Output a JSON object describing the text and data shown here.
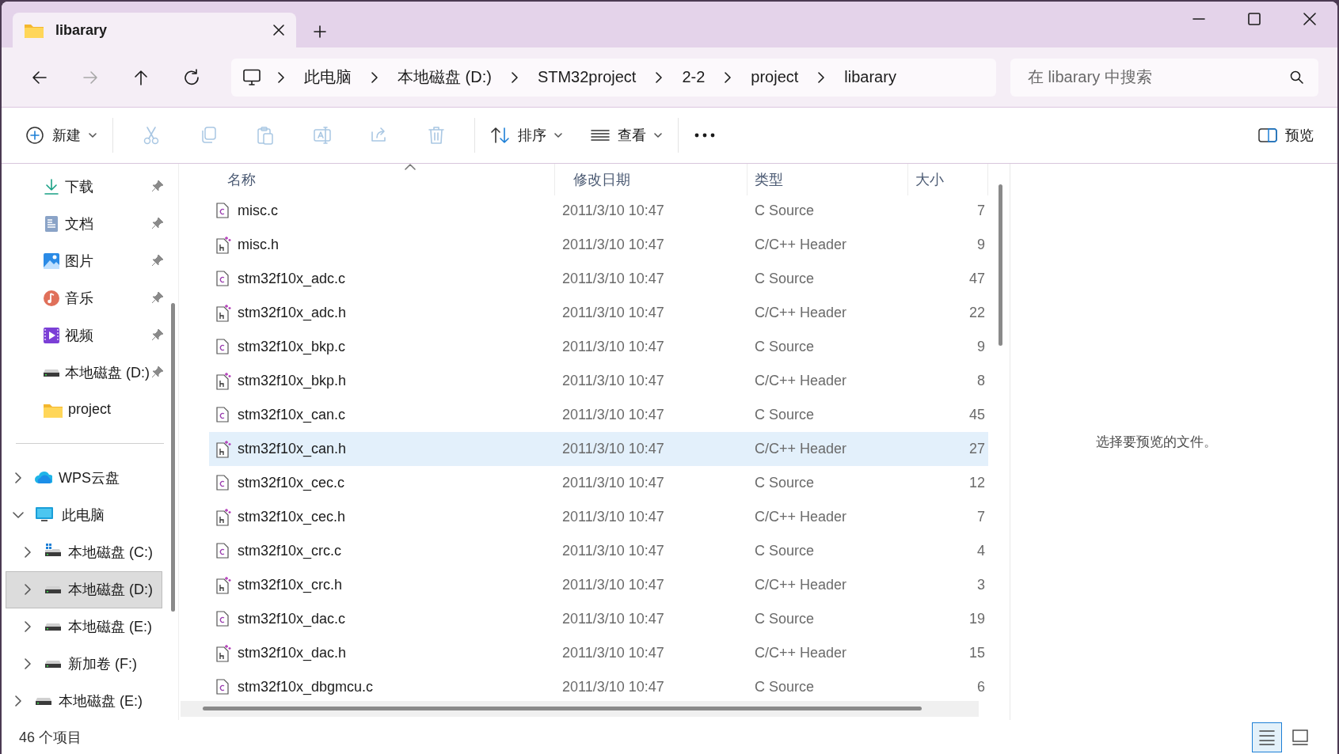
{
  "window": {
    "tabs": [
      {
        "title": "libarary",
        "selected": true
      }
    ]
  },
  "navigation": {
    "buttons": [
      {
        "kind": "back",
        "disabled": false
      },
      {
        "kind": "forward",
        "disabled": true
      },
      {
        "kind": "up",
        "disabled": false
      },
      {
        "kind": "refresh",
        "disabled": false
      }
    ],
    "breadcrumbs": [
      "此电脑",
      "本地磁盘 (D:)",
      "STM32project",
      "2-2",
      "project",
      "libarary"
    ],
    "search": {
      "placeholder": "在 libarary 中搜索"
    }
  },
  "toolbar": {
    "new": {
      "label": "新建"
    },
    "actions": [
      {
        "kind": "cut",
        "disabled": true
      },
      {
        "kind": "copy",
        "disabled": true
      },
      {
        "kind": "paste",
        "disabled": true
      },
      {
        "kind": "rename",
        "disabled": true
      },
      {
        "kind": "share",
        "disabled": true
      },
      {
        "kind": "delete",
        "disabled": true
      }
    ],
    "sort": {
      "label": "排序"
    },
    "view": {
      "label": "查看"
    },
    "preview": {
      "label": "预览"
    }
  },
  "sidebar": {
    "quick_access": [
      {
        "label": "下载",
        "kind": "download",
        "pinned": true
      },
      {
        "label": "文档",
        "kind": "document",
        "pinned": true
      },
      {
        "label": "图片",
        "kind": "picture",
        "pinned": true
      },
      {
        "label": "音乐",
        "kind": "music",
        "pinned": true
      },
      {
        "label": "视频",
        "kind": "video",
        "pinned": true
      },
      {
        "label": "本地磁盘 (D:)",
        "kind": "drive",
        "pinned": true
      },
      {
        "label": "project",
        "kind": "folder",
        "pinned": false
      }
    ],
    "tree": [
      {
        "label": "WPS云盘",
        "kind": "cloud",
        "expanded": false,
        "selected": false
      },
      {
        "label": "此电脑",
        "kind": "pc",
        "expanded": true,
        "selected": false,
        "children": [
          {
            "label": "本地磁盘 (C:)",
            "kind": "system-drive",
            "expanded": false,
            "selected": false
          },
          {
            "label": "本地磁盘 (D:)",
            "kind": "drive",
            "expanded": false,
            "selected": true
          },
          {
            "label": "本地磁盘 (E:)",
            "kind": "drive",
            "expanded": false,
            "selected": false
          },
          {
            "label": "新加卷 (F:)",
            "kind": "drive",
            "expanded": false,
            "selected": false
          }
        ]
      },
      {
        "label": "本地磁盘 (E:)",
        "kind": "drive",
        "expanded": false,
        "selected": false
      }
    ]
  },
  "table": {
    "columns": [
      {
        "label": "名称",
        "sorted": true
      },
      {
        "label": "修改日期",
        "sorted": false
      },
      {
        "label": "类型",
        "sorted": false
      },
      {
        "label": "大小",
        "sorted": false
      }
    ],
    "rows": [
      {
        "name": "misc.c",
        "kind": "c",
        "modified": "2011/3/10 10:47",
        "type": "C Source",
        "size": "7",
        "selected": false
      },
      {
        "name": "misc.h",
        "kind": "h",
        "modified": "2011/3/10 10:47",
        "type": "C/C++ Header",
        "size": "9",
        "selected": false
      },
      {
        "name": "stm32f10x_adc.c",
        "kind": "c",
        "modified": "2011/3/10 10:47",
        "type": "C Source",
        "size": "47",
        "selected": false
      },
      {
        "name": "stm32f10x_adc.h",
        "kind": "h",
        "modified": "2011/3/10 10:47",
        "type": "C/C++ Header",
        "size": "22",
        "selected": false
      },
      {
        "name": "stm32f10x_bkp.c",
        "kind": "c",
        "modified": "2011/3/10 10:47",
        "type": "C Source",
        "size": "9",
        "selected": false
      },
      {
        "name": "stm32f10x_bkp.h",
        "kind": "h",
        "modified": "2011/3/10 10:47",
        "type": "C/C++ Header",
        "size": "8",
        "selected": false
      },
      {
        "name": "stm32f10x_can.c",
        "kind": "c",
        "modified": "2011/3/10 10:47",
        "type": "C Source",
        "size": "45",
        "selected": false
      },
      {
        "name": "stm32f10x_can.h",
        "kind": "h",
        "modified": "2011/3/10 10:47",
        "type": "C/C++ Header",
        "size": "27",
        "selected": true
      },
      {
        "name": "stm32f10x_cec.c",
        "kind": "c",
        "modified": "2011/3/10 10:47",
        "type": "C Source",
        "size": "12",
        "selected": false
      },
      {
        "name": "stm32f10x_cec.h",
        "kind": "h",
        "modified": "2011/3/10 10:47",
        "type": "C/C++ Header",
        "size": "7",
        "selected": false
      },
      {
        "name": "stm32f10x_crc.c",
        "kind": "c",
        "modified": "2011/3/10 10:47",
        "type": "C Source",
        "size": "4",
        "selected": false
      },
      {
        "name": "stm32f10x_crc.h",
        "kind": "h",
        "modified": "2011/3/10 10:47",
        "type": "C/C++ Header",
        "size": "3",
        "selected": false
      },
      {
        "name": "stm32f10x_dac.c",
        "kind": "c",
        "modified": "2011/3/10 10:47",
        "type": "C Source",
        "size": "19",
        "selected": false
      },
      {
        "name": "stm32f10x_dac.h",
        "kind": "h",
        "modified": "2011/3/10 10:47",
        "type": "C/C++ Header",
        "size": "15",
        "selected": false
      },
      {
        "name": "stm32f10x_dbgmcu.c",
        "kind": "c",
        "modified": "2011/3/10 10:47",
        "type": "C Source",
        "size": "6",
        "selected": false
      }
    ]
  },
  "preview_pane": {
    "message": "选择要预览的文件。"
  },
  "status_bar": {
    "count": "46 个项目",
    "views": [
      {
        "kind": "details",
        "selected": true
      },
      {
        "kind": "tiles",
        "selected": false
      }
    ]
  }
}
